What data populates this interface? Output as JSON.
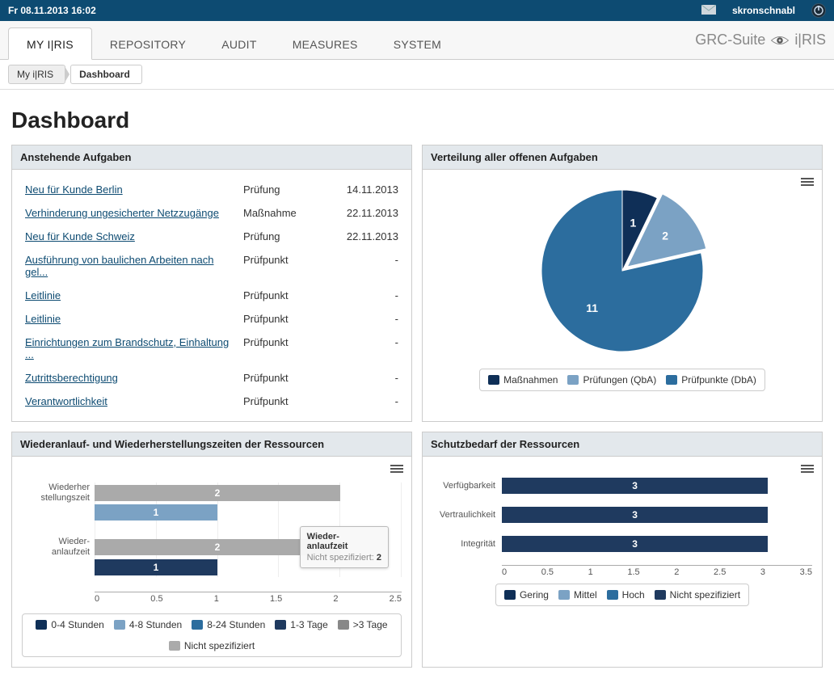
{
  "topbar": {
    "date": "Fr 08.11.2013 16:02",
    "username": "skronschnabl"
  },
  "nav": {
    "tabs": [
      "MY I|RIS",
      "REPOSITORY",
      "AUDIT",
      "MEASURES",
      "SYSTEM"
    ],
    "active": 0,
    "brand_prefix": "GRC-Suite",
    "brand_suffix": "i|RIS"
  },
  "breadcrumb": {
    "items": [
      "My i|RIS",
      "Dashboard"
    ]
  },
  "page": {
    "title": "Dashboard"
  },
  "widgets": {
    "tasks": {
      "title": "Anstehende Aufgaben",
      "rows": [
        {
          "name": "Neu für Kunde Berlin",
          "type": "Prüfung",
          "date": "14.11.2013"
        },
        {
          "name": "Verhinderung ungesicherter Netzzugänge",
          "type": "Maßnahme",
          "date": "22.11.2013"
        },
        {
          "name": "Neu für Kunde Schweiz",
          "type": "Prüfung",
          "date": "22.11.2013"
        },
        {
          "name": "Ausführung von baulichen Arbeiten nach gel...",
          "type": "Prüfpunkt",
          "date": "-"
        },
        {
          "name": "Leitlinie",
          "type": "Prüfpunkt",
          "date": "-"
        },
        {
          "name": "Leitlinie",
          "type": "Prüfpunkt",
          "date": "-"
        },
        {
          "name": "Einrichtungen zum Brandschutz, Einhaltung ...",
          "type": "Prüfpunkt",
          "date": "-"
        },
        {
          "name": "Zutrittsberechtigung",
          "type": "Prüfpunkt",
          "date": "-"
        },
        {
          "name": "Verantwortlichkeit",
          "type": "Prüfpunkt",
          "date": "-"
        }
      ]
    },
    "pie": {
      "title": "Verteilung aller offenen Aufgaben",
      "legend": [
        {
          "label": "Maßnahmen",
          "color": "#0f2f57"
        },
        {
          "label": "Prüfungen (QbA)",
          "color": "#7ba2c4"
        },
        {
          "label": "Prüfpunkte (DbA)",
          "color": "#2c6d9e"
        }
      ]
    },
    "recovery": {
      "title": "Wiederanlauf- und Wiederherstellungszeiten der Ressourcen",
      "categories": [
        "Wiederher\nstellungszeit",
        "Wieder-\nanlaufzeit"
      ],
      "ticks": [
        "0",
        "0.5",
        "1",
        "1.5",
        "2",
        "2.5"
      ],
      "legend": [
        {
          "label": "0-4 Stunden",
          "color": "#0f2f57"
        },
        {
          "label": "4-8 Stunden",
          "color": "#7ba2c4"
        },
        {
          "label": "8-24 Stunden",
          "color": "#2c6d9e"
        },
        {
          "label": "1-3 Tage",
          "color": "#1f3a5f"
        },
        {
          "label": ">3 Tage",
          "color": "#888"
        },
        {
          "label": "Nicht spezifiziert",
          "color": "#aaa"
        }
      ],
      "tooltip": {
        "title": "Wieder-\nanlaufzeit",
        "label": "Nicht spezifiziert:",
        "value": "2"
      }
    },
    "protection": {
      "title": "Schutzbedarf der Ressourcen",
      "categories": [
        "Verfügbarkeit",
        "Vertraulichkeit",
        "Integrität"
      ],
      "ticks": [
        "0",
        "0.5",
        "1",
        "1.5",
        "2",
        "2.5",
        "3",
        "3.5"
      ],
      "legend": [
        {
          "label": "Gering",
          "color": "#0f2f57"
        },
        {
          "label": "Mittel",
          "color": "#7ba2c4"
        },
        {
          "label": "Hoch",
          "color": "#2c6d9e"
        },
        {
          "label": "Nicht spezifiziert",
          "color": "#1f3a5f"
        }
      ]
    }
  },
  "chart_data": [
    {
      "type": "pie",
      "title": "Verteilung aller offenen Aufgaben",
      "series": [
        {
          "name": "Maßnahmen",
          "value": 1,
          "color": "#0f2f57"
        },
        {
          "name": "Prüfungen (QbA)",
          "value": 2,
          "color": "#7ba2c4"
        },
        {
          "name": "Prüfpunkte (DbA)",
          "value": 11,
          "color": "#2c6d9e"
        }
      ]
    },
    {
      "type": "bar",
      "orientation": "horizontal",
      "title": "Wiederanlauf- und Wiederherstellungszeiten der Ressourcen",
      "categories": [
        "Wiederherstellungszeit",
        "Wiederanlaufzeit"
      ],
      "series": [
        {
          "name": "0-4 Stunden",
          "values": [
            0,
            0
          ],
          "color": "#0f2f57"
        },
        {
          "name": "4-8 Stunden",
          "values": [
            1,
            0
          ],
          "color": "#7ba2c4"
        },
        {
          "name": "8-24 Stunden",
          "values": [
            0,
            0
          ],
          "color": "#2c6d9e"
        },
        {
          "name": "1-3 Tage",
          "values": [
            0,
            1
          ],
          "color": "#1f3a5f"
        },
        {
          "name": ">3 Tage",
          "values": [
            0,
            0
          ],
          "color": "#888"
        },
        {
          "name": "Nicht spezifiziert",
          "values": [
            2,
            2
          ],
          "color": "#aaa"
        }
      ],
      "xlim": [
        0,
        2.5
      ]
    },
    {
      "type": "bar",
      "orientation": "horizontal",
      "title": "Schutzbedarf der Ressourcen",
      "categories": [
        "Verfügbarkeit",
        "Vertraulichkeit",
        "Integrität"
      ],
      "series": [
        {
          "name": "Gering",
          "values": [
            0,
            0,
            0
          ],
          "color": "#0f2f57"
        },
        {
          "name": "Mittel",
          "values": [
            0,
            0,
            0
          ],
          "color": "#7ba2c4"
        },
        {
          "name": "Hoch",
          "values": [
            0,
            0,
            0
          ],
          "color": "#2c6d9e"
        },
        {
          "name": "Nicht spezifiziert",
          "values": [
            3,
            3,
            3
          ],
          "color": "#1f3a5f"
        }
      ],
      "xlim": [
        0,
        3.5
      ]
    }
  ]
}
